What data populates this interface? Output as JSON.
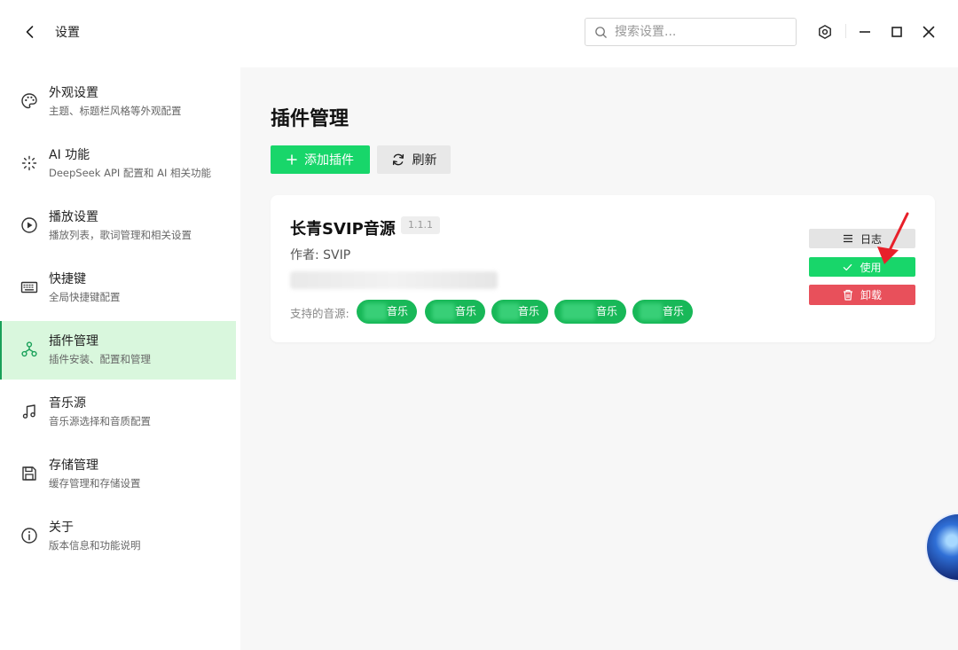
{
  "window": {
    "title": "设置",
    "search_placeholder": "搜索设置..."
  },
  "sidebar": {
    "items": [
      {
        "label": "外观设置",
        "desc": "主题、标题栏风格等外观配置",
        "icon": "palette-icon"
      },
      {
        "label": "AI 功能",
        "desc": "DeepSeek API 配置和 AI 相关功能",
        "icon": "ai-sparkle-icon"
      },
      {
        "label": "播放设置",
        "desc": "播放列表，歌词管理和相关设置",
        "icon": "play-circle-icon"
      },
      {
        "label": "快捷键",
        "desc": "全局快捷键配置",
        "icon": "keyboard-icon"
      },
      {
        "label": "插件管理",
        "desc": "插件安装、配置和管理",
        "icon": "plugin-nodes-icon",
        "active": true
      },
      {
        "label": "音乐源",
        "desc": "音乐源选择和音质配置",
        "icon": "music-note-icon"
      },
      {
        "label": "存储管理",
        "desc": "缓存管理和存储设置",
        "icon": "save-icon"
      },
      {
        "label": "关于",
        "desc": "版本信息和功能说明",
        "icon": "info-icon"
      }
    ]
  },
  "main": {
    "title": "插件管理",
    "add_label": "添加插件",
    "refresh_label": "刷新"
  },
  "plugin": {
    "name": "长青SVIP音源",
    "version": "1.1.1",
    "author": "作者: SVIP",
    "sources_label": "支持的音源:",
    "sources": [
      "音乐",
      "音乐",
      "音乐",
      "音乐",
      "音乐"
    ],
    "log_label": "日志",
    "use_label": "使用",
    "uninstall_label": "卸载"
  },
  "colors": {
    "accent": "#18d66a",
    "tag": "#18b858",
    "danger": "#e8505b",
    "active_bg": "#d9f7dd",
    "annotation_arrow": "#e8202a"
  }
}
